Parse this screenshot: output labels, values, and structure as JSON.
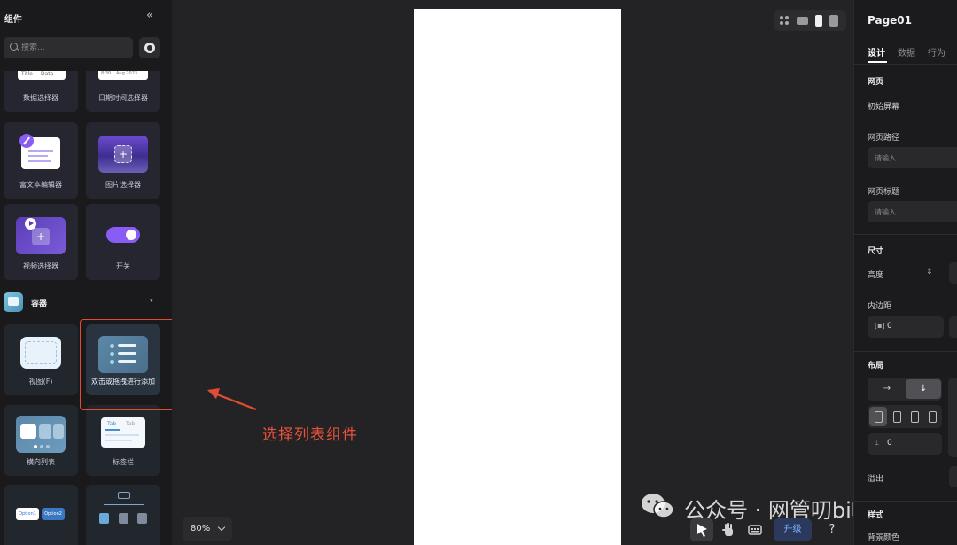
{
  "left_panel": {
    "title": "组件",
    "collapse_glyph": "«",
    "search_placeholder": "搜索...",
    "items_row1": [
      {
        "label": "数据选择器",
        "thumb_text_a": "Title",
        "thumb_text_b": "Data"
      },
      {
        "label": "日期时间选择器",
        "thumb_text_a": "8:30",
        "thumb_text_b": "Aug 2023"
      }
    ],
    "items_row2": [
      {
        "label": "富文本编辑器"
      },
      {
        "label": "图片选择器"
      }
    ],
    "items_row3": [
      {
        "label": "视频选择器"
      },
      {
        "label": "开关"
      }
    ],
    "section": {
      "title": "容器",
      "caret": "▾"
    },
    "items_row4": [
      {
        "label": "视图(F)"
      },
      {
        "label": "双击或拖拽进行添加"
      }
    ],
    "items_row5": [
      {
        "label": "横向列表"
      },
      {
        "label": "标签栏",
        "tab_a": "Tab",
        "tab_b": "Tab"
      }
    ],
    "items_row6": [
      {
        "opt_a": "Option1",
        "opt_b": "Option2"
      }
    ]
  },
  "annotation": {
    "text": "选择列表组件",
    "color": "#e9513b"
  },
  "canvas": {
    "zoom": "80%",
    "upgrade_label": "升级",
    "help_label": "?"
  },
  "watermark": {
    "text": "公众号 · 网管叨bi叨"
  },
  "right_panel": {
    "title": "Page01",
    "tabs": [
      {
        "label": "设计",
        "active": true
      },
      {
        "label": "数据",
        "active": false
      },
      {
        "label": "行为",
        "active": false
      }
    ],
    "webpage_section": "网页",
    "initial_screen_label": "初始屏幕",
    "path_label": "网页路径",
    "path_placeholder": "请输入...",
    "page_title_label": "网页标题",
    "page_title_placeholder": "请输入...",
    "size_section": "尺寸",
    "height_label": "高度",
    "padding_label": "内边距",
    "padding_value": "0",
    "layout_section": "布局",
    "gap_value": "0",
    "overflow_label": "溢出",
    "style_section": "样式",
    "bg_color_label": "背景颜色"
  },
  "colors": {
    "accent_purple": "#7b5cff",
    "annotation_red": "#e44b35",
    "upgrade_blue": "#7fb0ff"
  }
}
